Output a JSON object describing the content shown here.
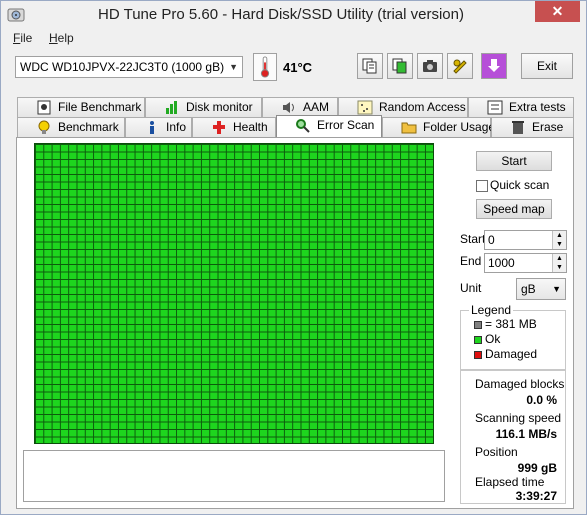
{
  "window": {
    "title": "HD Tune Pro 5.60 - Hard Disk/SSD Utility (trial version)",
    "close_glyph": "✕"
  },
  "menu": {
    "file": {
      "accel": "F",
      "rest": "ile"
    },
    "help": {
      "accel": "H",
      "rest": "elp"
    }
  },
  "toolbar": {
    "drive": "WDC WD10JPVX-22JC3T0 (1000 gB)",
    "temperature": "41°C",
    "exit_label": "Exit"
  },
  "tabs_top": [
    {
      "label": "File Benchmark",
      "icon": "file-benchmark-icon"
    },
    {
      "label": "Disk monitor",
      "icon": "disk-monitor-icon"
    },
    {
      "label": "AAM",
      "icon": "speaker-icon"
    },
    {
      "label": "Random Access",
      "icon": "random-access-icon"
    },
    {
      "label": "Extra tests",
      "icon": "extra-tests-icon"
    }
  ],
  "tabs_bottom": [
    {
      "label": "Benchmark",
      "icon": "lightbulb-icon"
    },
    {
      "label": "Info",
      "icon": "info-icon"
    },
    {
      "label": "Health",
      "icon": "health-cross-icon"
    },
    {
      "label": "Error Scan",
      "icon": "magnifier-icon",
      "active": true
    },
    {
      "label": "Folder Usage",
      "icon": "folder-icon"
    },
    {
      "label": "Erase",
      "icon": "trash-icon"
    }
  ],
  "controls": {
    "start_button": "Start",
    "quick_scan_label": "Quick scan",
    "quick_scan_checked": false,
    "speed_map_button": "Speed map",
    "start_label": "Start",
    "start_value": "0",
    "end_label": "End",
    "end_value": "1000",
    "unit_label": "Unit",
    "unit_value": "gB"
  },
  "legend": {
    "title": "Legend",
    "items": [
      {
        "label": "= 381 MB",
        "color": "#808080"
      },
      {
        "label": "Ok",
        "color": "#1ed51e"
      },
      {
        "label": "Damaged",
        "color": "#e01010"
      }
    ]
  },
  "stats": {
    "damaged_blocks_label": "Damaged blocks",
    "damaged_blocks_value": "0.0 %",
    "scanning_speed_label": "Scanning speed",
    "scanning_speed_value": "116.1 MB/s",
    "position_label": "Position",
    "position_value": "999 gB",
    "elapsed_label": "Elapsed time",
    "elapsed_value": "3:39:27"
  },
  "colors": {
    "ok_block": "#1ed51e",
    "grid_line": "#0d5c0d"
  }
}
